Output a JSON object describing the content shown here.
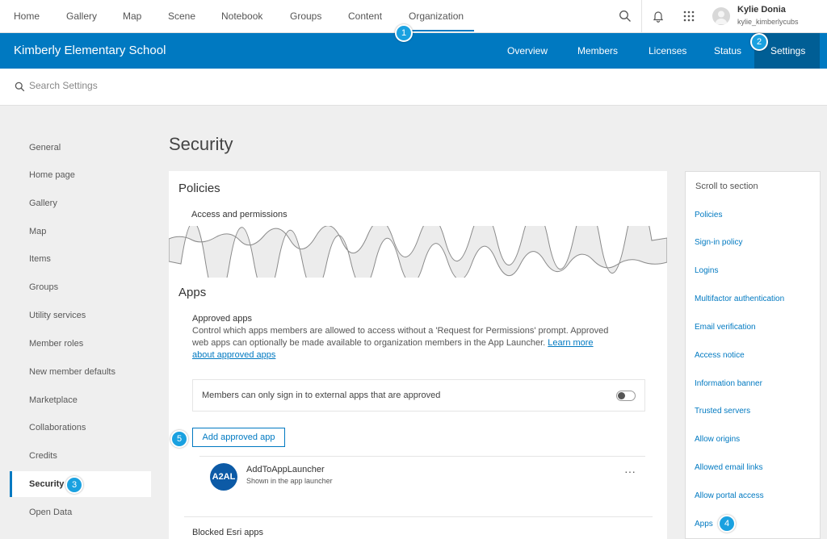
{
  "topnav": {
    "items": [
      "Home",
      "Gallery",
      "Map",
      "Scene",
      "Notebook",
      "Groups",
      "Content",
      "Organization"
    ],
    "active_index": 7,
    "icons": [
      "search-icon",
      "bell-icon",
      "app-launcher-icon"
    ],
    "user": {
      "name": "Kylie Donia",
      "username": "kylie_kimberlycubs"
    }
  },
  "org": {
    "title": "Kimberly Elementary School",
    "tabs": [
      "Overview",
      "Members",
      "Licenses",
      "Status",
      "Settings"
    ],
    "active_tab": "Settings"
  },
  "search": {
    "placeholder": "Search Settings"
  },
  "sidebar": {
    "items": [
      "General",
      "Home page",
      "Gallery",
      "Map",
      "Items",
      "Groups",
      "Utility services",
      "Member roles",
      "New member defaults",
      "Marketplace",
      "Collaborations",
      "Credits",
      "Security",
      "Open Data"
    ],
    "active": "Security"
  },
  "page": {
    "title": "Security"
  },
  "policies": {
    "title": "Policies",
    "subtitle": "Access and permissions"
  },
  "apps": {
    "title": "Apps",
    "approved_title": "Approved apps",
    "description": "Control which apps members are allowed to access without a 'Request for Permissions' prompt. Approved web apps can optionally be made available to organization members in the App Launcher.",
    "learn_more": "Learn more about approved apps",
    "toggle_label": "Members can only sign in to external apps that are approved",
    "toggle_on": false,
    "add_button": "Add approved app",
    "app": {
      "logo_text": "A2AL",
      "name": "AddToAppLauncher",
      "status": "Shown in the app launcher",
      "more": "···"
    },
    "blocked_title": "Blocked Esri apps"
  },
  "scroll_panel": {
    "heading": "Scroll to section",
    "links": [
      "Policies",
      "Sign-in policy",
      "Logins",
      "Multifactor authentication",
      "Email verification",
      "Access notice",
      "Information banner",
      "Trusted servers",
      "Allow origins",
      "Allowed email links",
      "Allow portal access",
      "Apps"
    ]
  },
  "callouts": [
    "1",
    "2",
    "3",
    "4",
    "5"
  ],
  "colors": {
    "brand_blue": "#0079c1",
    "active_tab_bg": "#005e95",
    "callout": "#1aa1e0"
  }
}
